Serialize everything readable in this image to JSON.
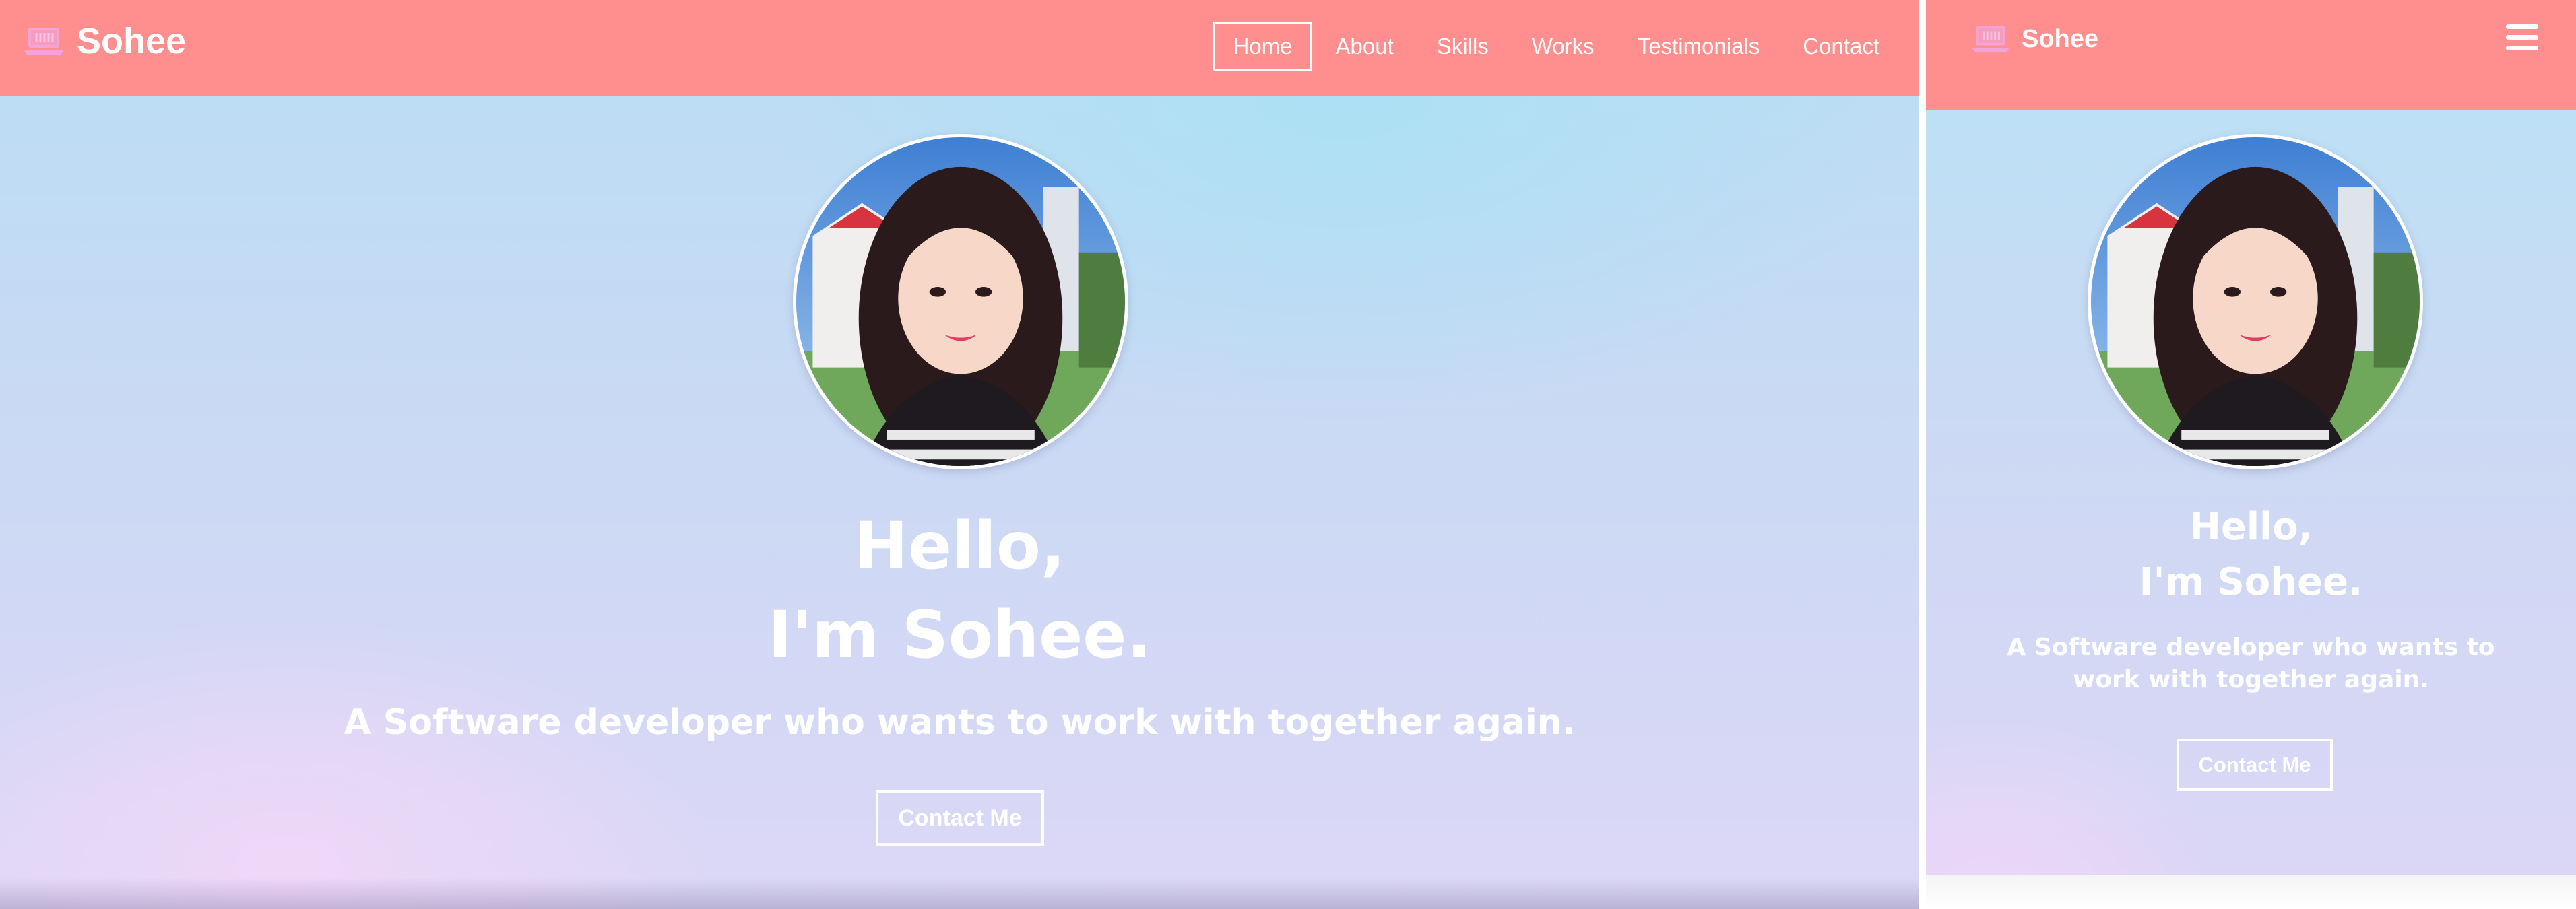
{
  "brand": {
    "name": "Sohee",
    "logo_icon": "laptop-icon",
    "logo_color": "#f3a3d6"
  },
  "navbar": {
    "background_color": "#ff8e8e",
    "items": [
      {
        "label": "Home",
        "active": true
      },
      {
        "label": "About"
      },
      {
        "label": "Skills"
      },
      {
        "label": "Works"
      },
      {
        "label": "Testimonials"
      },
      {
        "label": "Contact"
      }
    ],
    "menu_icon": "hamburger-menu-icon"
  },
  "hero": {
    "greeting_line1": "Hello,",
    "greeting_line2": "I'm Sohee.",
    "tagline": "A Software developer who wants to work with together again.",
    "cta_label": "Contact Me",
    "profile_image": "portrait of smiling woman outdoors"
  }
}
